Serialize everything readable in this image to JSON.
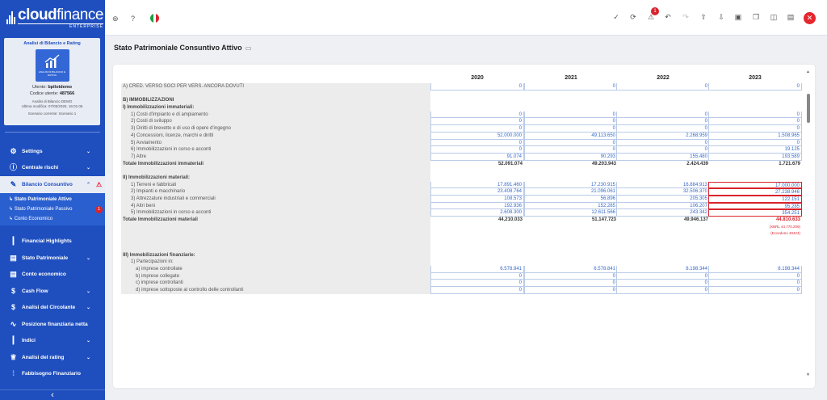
{
  "brand": {
    "name_bold": "cloud",
    "name_light": "finance",
    "edition": "ENTERPRISE"
  },
  "user_card": {
    "title": "Analisi di Bilancio e Rating",
    "thumb_caption": "ANALISI DI BILANCIO E RATING",
    "user_label": "Utente:",
    "user": "bpilotdemo",
    "code_label": "Codice utente:",
    "code": "487566",
    "analysis": "Analisi di Bilancio DEMO",
    "last_edit": "Ultima modifica: 07/05/2025, 16:01:05",
    "scenario": "Scenario corrente: Scenario 1"
  },
  "menu": {
    "settings": "Settings",
    "centrale": "Centrale rischi",
    "bilancio": "Bilancio Consuntivo",
    "sub": {
      "attivo": "Stato Patrimoniale Attivo",
      "passivo": "Stato Patrimoniale Passivo",
      "passivo_badge": "1",
      "ce": "Conto Economico"
    },
    "financial": "Financial Highlights",
    "stato": "Stato Patrimoniale",
    "conto": "Conto economico",
    "cashflow": "Cash Flow",
    "circolante": "Analisi del Circolante",
    "posizione": "Posizione finanziaria netta",
    "indici": "Indici",
    "rating": "Analisi del rating",
    "fabbisogno": "Fabbisogno Finanziario"
  },
  "topbar": {
    "notification_count": "1"
  },
  "page": {
    "title": "Stato Patrimoniale Consuntivo Attivo"
  },
  "table": {
    "years": [
      "2020",
      "2021",
      "2022",
      "2023"
    ],
    "r0": {
      "label": "A) CRED. VERSO SOCI PER VERS. ANCORA DOVUTI",
      "v": [
        "0",
        "0",
        "0",
        "0"
      ]
    },
    "r1": {
      "label": ""
    },
    "r2": {
      "label": "B) IMMOBILIZZAZIONI"
    },
    "r3": {
      "label": "I) Immobilizzazioni immateriali:"
    },
    "r4": {
      "label": "1) Costi d'impianto e di ampiamento",
      "v": [
        "0",
        "0",
        "0",
        "0"
      ]
    },
    "r5": {
      "label": "2) Costi di sviluppo",
      "v": [
        "0",
        "0",
        "0",
        "0"
      ]
    },
    "r6": {
      "label": "3) Diritti di brevetto e di uso di opere d'ingegno",
      "v": [
        "0",
        "0",
        "0",
        "0"
      ]
    },
    "r7": {
      "label": "4) Concessioni, licenze, marchi e diritti",
      "v": [
        "52.000.000",
        "49.113.650",
        "2.268.959",
        "1.508.965"
      ]
    },
    "r8": {
      "label": "5) Avviamento",
      "v": [
        "0",
        "0",
        "0",
        "0"
      ]
    },
    "r9": {
      "label": "6) Immobilizzazioni in corso e acconti",
      "v": [
        "0",
        "0",
        "0",
        "19.125"
      ]
    },
    "r10": {
      "label": "7) Altre",
      "v": [
        "91.074",
        "90.293",
        "155.480",
        "193.589"
      ]
    },
    "r11": {
      "label": "Totale Immobilizzazioni immateriali",
      "v": [
        "52.091.074",
        "49.203.943",
        "2.424.439",
        "1.721.679"
      ]
    },
    "r12": {
      "label": ""
    },
    "r13": {
      "label": "II) Immobilizzazioni materiali:"
    },
    "r14": {
      "label": "1) Terreni e fabbricati",
      "v": [
        "17.891.460",
        "17.230.915",
        "16.884.913",
        "17.000.000"
      ]
    },
    "r15": {
      "label": "2) Impianti e macchinario",
      "v": [
        "23.408.764",
        "21.096.061",
        "32.506.370",
        "27.238.946"
      ]
    },
    "r16": {
      "label": "3) Attrezzature industriali e commerciali",
      "v": [
        "108.573",
        "56.896",
        "205.305",
        "122.151"
      ]
    },
    "r17": {
      "label": "4) Altri beni",
      "v": [
        "192.936",
        "152.285",
        "106.207",
        "95.285"
      ]
    },
    "r18": {
      "label": "5) Immobilizzazioni in corso e acconti",
      "v": [
        "2.608.300",
        "12.611.566",
        "243.342",
        "354.251"
      ]
    },
    "r19": {
      "label": "Totale Immobilizzazioni materiali",
      "v": [
        "44.210.033",
        "51.147.723",
        "49.946.137",
        "44.810.633"
      ]
    },
    "r20": {
      "label": "",
      "note": "(XBRL 44.770.209)"
    },
    "r21": {
      "label": "",
      "note": "(Eccedono 40424)"
    },
    "r22": {
      "label": ""
    },
    "r23": {
      "label": ""
    },
    "r24": {
      "label": "III) Immobilizzazioni finanziarie:"
    },
    "r25": {
      "label": "1) Partecipazioni in:"
    },
    "r26": {
      "label": "a) imprese controllate",
      "v": [
        "6.578.841",
        "6.578.841",
        "8.198.344",
        "8.198.344"
      ]
    },
    "r27": {
      "label": "b) imprese collegate",
      "v": [
        "0",
        "0",
        "0",
        "0"
      ]
    },
    "r28": {
      "label": "c) imprese controllanti",
      "v": [
        "0",
        "0",
        "0",
        "0"
      ]
    },
    "r29": {
      "label": "d) imprese sottoposte al controllo delle controllanti",
      "v": [
        "0",
        "0",
        "0",
        "0"
      ]
    }
  },
  "colors": {
    "primary": "#1f4fbf",
    "error": "#d9242c",
    "value": "#3568c8"
  }
}
